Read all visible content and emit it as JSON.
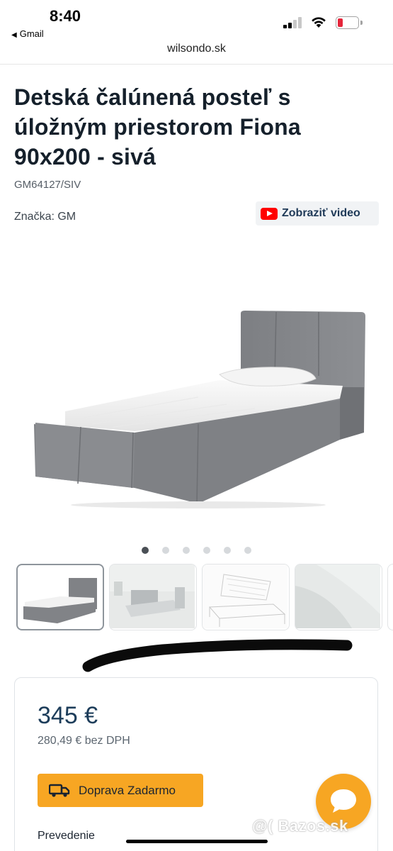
{
  "status_bar": {
    "time": "8:40",
    "back_app": "Gmail"
  },
  "browser": {
    "url": "wilsondo.sk"
  },
  "product": {
    "title": "Detská čalúnená posteľ s úložným priestorom Fiona 90x200 - sivá",
    "sku": "GM64127/SIV",
    "brand_label": "Značka: GM",
    "video_button": "Zobraziť video"
  },
  "gallery": {
    "image_count": 6,
    "active_index": 0,
    "thumbnail_count_visible": 4
  },
  "pricing": {
    "price": "345 €",
    "price_without_vat": "280,49 € bez DPH",
    "shipping_button": "Doprava Zadarmo",
    "variant_label": "Prevedenie"
  },
  "watermark": "@( Bazos.sk",
  "colors": {
    "accent_orange": "#f7a623",
    "heading_navy": "#15202b",
    "price_navy": "#1d3d5a",
    "youtube_red": "#ff0000",
    "battery_red": "#e5253a"
  }
}
